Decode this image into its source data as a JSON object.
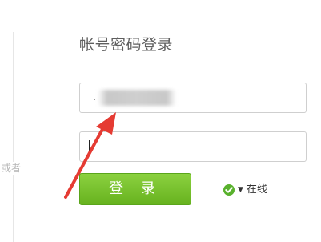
{
  "login": {
    "title": "帐号密码登录",
    "account_value": ".",
    "password_value": "",
    "button_label": "登 录",
    "status_label": "在线",
    "or_label": "或者"
  },
  "colors": {
    "button_green": "#6bbd24",
    "status_green": "#59b12d",
    "annotation_red": "#e53b33"
  },
  "icons": {
    "status": "online-check-icon",
    "dropdown": "triangle-down-icon"
  }
}
